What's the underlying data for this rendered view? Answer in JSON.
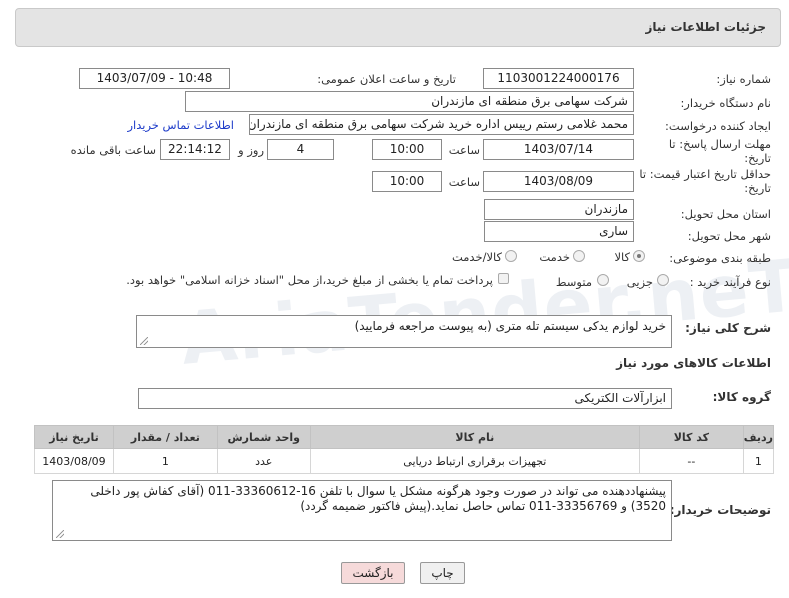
{
  "header": {
    "title": "جزئیات اطلاعات نیاز"
  },
  "watermark": "AriaTender.neT",
  "fields": {
    "need_number": {
      "label": "شماره نیاز:",
      "value": "1103001224000176"
    },
    "announce": {
      "label": "تاریخ و ساعت اعلان عمومی:",
      "value": "1403/07/09 - 10:48"
    },
    "buyer_org": {
      "label": "نام دستگاه خریدار:",
      "value": "شرکت سهامی برق منطقه ای مازندران"
    },
    "requester": {
      "label": "ایجاد کننده درخواست:",
      "value": "محمد غلامی رستم رییس اداره خرید شرکت سهامی برق منطقه ای مازندران",
      "link": "اطلاعات تماس خریدار"
    },
    "reply_deadline": {
      "label_line1": "مهلت ارسال پاسخ: تا",
      "label_line2": "تاریخ:",
      "date": "1403/07/14",
      "time_label": "ساعت",
      "time": "10:00",
      "days": "4",
      "days_label": "روز و",
      "remaining": "22:14:12",
      "remaining_label": "ساعت باقی مانده"
    },
    "price_validity": {
      "label_line1": "حداقل تاریخ اعتبار قیمت: تا",
      "label_line2": "تاریخ:",
      "date": "1403/08/09",
      "time_label": "ساعت",
      "time": "10:00"
    },
    "province": {
      "label": "استان محل تحویل:",
      "value": "مازندران"
    },
    "city": {
      "label": "شهر محل تحویل:",
      "value": "ساری"
    },
    "category": {
      "label": "طبقه بندی موضوعی:",
      "options": [
        "کالا",
        "خدمت",
        "کالا/خدمت"
      ],
      "selected": "کالا"
    },
    "process": {
      "label": "نوع فرآیند خرید :",
      "options": [
        "جزیی",
        "متوسط"
      ],
      "note": "پرداخت تمام یا بخشی از مبلغ خرید،از محل \"اسناد خزانه اسلامی\" خواهد بود."
    },
    "description": {
      "label": "شرح کلی نیاز:",
      "value": "خرید لوازم یدکی سیستم تله متری (به پیوست مراجعه فرمایید)"
    }
  },
  "goods_section": {
    "title": "اطلاعات کالاهای مورد نیاز"
  },
  "goods_group": {
    "label": "گروه کالا:",
    "value": "ابزارآلات الکتریکی"
  },
  "goods_table": {
    "headers": [
      "ردیف",
      "کد کالا",
      "نام کالا",
      "واحد شمارش",
      "تعداد / مقدار",
      "تاریخ نیاز"
    ],
    "rows": [
      [
        "1",
        "--",
        "تجهیزات برقراری ارتباط دریایی",
        "عدد",
        "1",
        "1403/08/09"
      ]
    ]
  },
  "buyer_notes": {
    "label": "توضیحات خریدار:",
    "value": "پیشنهاددهنده می تواند در صورت وجود هرگونه مشکل یا سوال با تلفن 16-33360612-011 (آقای کفاش پور داخلی 3520) و 33356769-011  تماس حاصل نماید.(پیش فاکتور ضمیمه گردد)"
  },
  "buttons": {
    "print": "چاپ",
    "back": "بازگشت"
  },
  "colors": {
    "link": "#1d3bc9",
    "back_button_bg": "#f6dada"
  }
}
